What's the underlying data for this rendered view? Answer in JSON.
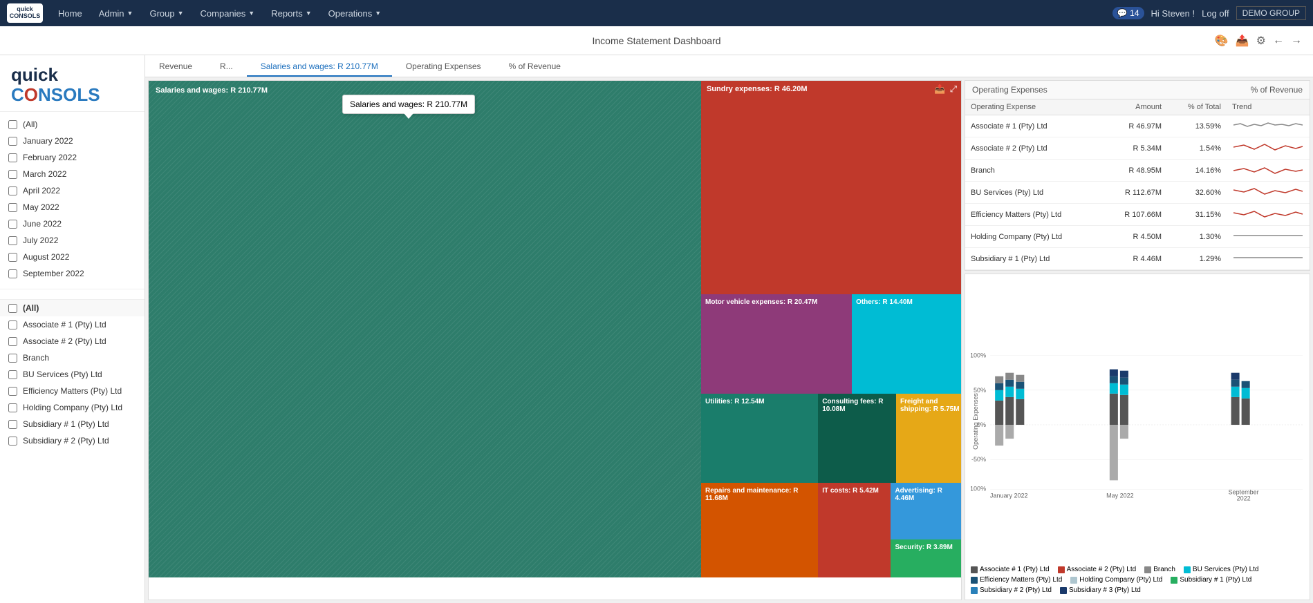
{
  "nav": {
    "logo": "quick CONSOLS",
    "items": [
      {
        "label": "Home",
        "hasArrow": false
      },
      {
        "label": "Admin",
        "hasArrow": true
      },
      {
        "label": "Group",
        "hasArrow": true
      },
      {
        "label": "Companies",
        "hasArrow": true
      },
      {
        "label": "Reports",
        "hasArrow": true
      },
      {
        "label": "Operations",
        "hasArrow": true
      }
    ],
    "messages": "14",
    "user": "Hi Steven !",
    "logout": "Log off",
    "demo": "DEMO GROUP"
  },
  "page": {
    "title": "Income Statement Dashboard"
  },
  "page_actions": [
    "palette-icon",
    "share-icon",
    "settings-icon",
    "back-icon",
    "forward-icon"
  ],
  "sidebar": {
    "months_header": "",
    "months": [
      {
        "label": "(All)",
        "checked": false
      },
      {
        "label": "January 2022",
        "checked": false
      },
      {
        "label": "February 2022",
        "checked": false
      },
      {
        "label": "March 2022",
        "checked": false
      },
      {
        "label": "April 2022",
        "checked": false
      },
      {
        "label": "May 2022",
        "checked": false
      },
      {
        "label": "June 2022",
        "checked": false
      },
      {
        "label": "July 2022",
        "checked": false
      },
      {
        "label": "August 2022",
        "checked": false
      },
      {
        "label": "September 2022",
        "checked": false
      }
    ],
    "companies_all": "(All)",
    "companies": [
      {
        "label": "Associate # 1 (Pty) Ltd",
        "checked": false
      },
      {
        "label": "Associate # 2 (Pty) Ltd",
        "checked": false
      },
      {
        "label": "Branch",
        "checked": false
      },
      {
        "label": "BU Services (Pty) Ltd",
        "checked": false
      },
      {
        "label": "Efficiency Matters (Pty) Ltd",
        "checked": false
      },
      {
        "label": "Holding Company (Pty) Ltd",
        "checked": false
      },
      {
        "label": "Subsidiary # 1 (Pty) Ltd",
        "checked": false
      },
      {
        "label": "Subsidiary # 2 (Pty) Ltd",
        "checked": false
      }
    ]
  },
  "tabs": [
    {
      "label": "Revenue",
      "active": false
    },
    {
      "label": "R...",
      "active": false
    },
    {
      "label": "Salaries and wages: R 210.77M",
      "active": true,
      "tooltip": true
    },
    {
      "label": "Operating Expenses",
      "active": false
    },
    {
      "label": "% of Revenue",
      "active": false
    }
  ],
  "treemap": {
    "main_label": "Salaries and wages: R 210.77M",
    "blocks": [
      {
        "label": "Sundry expenses: R 46.20M",
        "color": "#c0392b"
      },
      {
        "label": "Motor vehicle expenses: R 20.47M",
        "color": "#8e3a79"
      },
      {
        "label": "Others: R 14.40M",
        "color": "#00bcd4"
      },
      {
        "label": "Utilities: R 12.54M",
        "color": "#1a7d6b"
      },
      {
        "label": "Consulting fees: R 10.08M",
        "color": "#0d5c4a"
      },
      {
        "label": "Freight and shipping: R 5.75M",
        "color": "#e6a817"
      },
      {
        "label": "Repairs and maintenance: R 11.68M",
        "color": "#d35400"
      },
      {
        "label": "IT costs: R 5.42M",
        "color": "#c0392b"
      },
      {
        "label": "Advertising: R 4.46M",
        "color": "#27ae60"
      },
      {
        "label": "Security: R 3.89M",
        "color": "#27ae60"
      }
    ]
  },
  "op_table": {
    "title": "Operating Expenses",
    "columns": [
      "Operating Expense",
      "Amount",
      "% of Total",
      "Trend"
    ],
    "rows": [
      {
        "name": "Associate # 1 (Pty) Ltd",
        "amount": "R 46.97M",
        "pct": "13.59%"
      },
      {
        "name": "Associate # 2 (Pty) Ltd",
        "amount": "R 5.34M",
        "pct": "1.54%"
      },
      {
        "name": "Branch",
        "amount": "R 48.95M",
        "pct": "14.16%"
      },
      {
        "name": "BU Services (Pty) Ltd",
        "amount": "R 112.67M",
        "pct": "32.60%"
      },
      {
        "name": "Efficiency Matters (Pty) Ltd",
        "amount": "R 107.66M",
        "pct": "31.15%"
      },
      {
        "name": "Holding Company (Pty) Ltd",
        "amount": "R 4.50M",
        "pct": "1.30%"
      },
      {
        "name": "Subsidiary # 1 (Pty) Ltd",
        "amount": "R 4.46M",
        "pct": "1.29%"
      }
    ]
  },
  "chart": {
    "y_labels": [
      "100%",
      "50%",
      "0%",
      "-50%",
      "-100%"
    ],
    "x_labels": [
      "January 2022",
      "May 2022",
      "September 2022"
    ],
    "y_axis_label": "Operating Expenses"
  },
  "legend": [
    {
      "label": "Associate # 1 (Pty) Ltd",
      "color": "#555555"
    },
    {
      "label": "Associate # 2 (Pty) Ltd",
      "color": "#c0392b"
    },
    {
      "label": "Branch",
      "color": "#888888"
    },
    {
      "label": "BU Services (Pty) Ltd",
      "color": "#00bcd4"
    },
    {
      "label": "Efficiency Matters (Pty) Ltd",
      "color": "#1a5276"
    },
    {
      "label": "Holding Company (Pty) Ltd",
      "color": "#aec6cf"
    },
    {
      "label": "Subsidiary # 1 (Pty) Ltd",
      "color": "#27ae60"
    },
    {
      "label": "Subsidiary # 2 (Pty) Ltd",
      "color": "#2980b9"
    },
    {
      "label": "Subsidiary # 3 (Pty) Ltd",
      "color": "#1a3a6b"
    }
  ]
}
